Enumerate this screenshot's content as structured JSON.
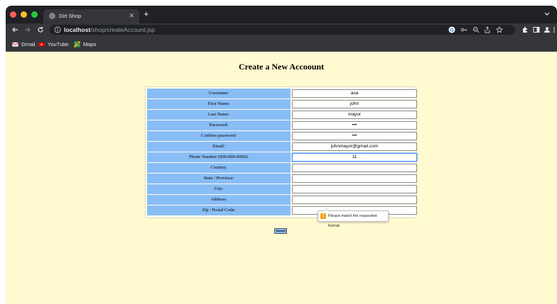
{
  "browser": {
    "tab_title": "Dirt Shop",
    "url_host": "localhost",
    "url_path": "/shop/createAccount.jsp",
    "bookmarks": [
      "Gmail",
      "YouTube",
      "Maps"
    ]
  },
  "page": {
    "title": "Create a New Accoount",
    "submit_label": "Submit",
    "fields": [
      {
        "label": "Username:",
        "value": "asa"
      },
      {
        "label": "First Name:",
        "value": "john"
      },
      {
        "label": "Last Name:",
        "value": "mayor"
      },
      {
        "label": "Password:",
        "value": "•••"
      },
      {
        "label": "Confirm password:",
        "value": "•••"
      },
      {
        "label": "Email:",
        "value": "johnmayor@gmail.com"
      },
      {
        "label": "Phone Number (000-000-0000):",
        "value": "11"
      },
      {
        "label": "Country:",
        "value": ""
      },
      {
        "label": "State / Province:",
        "value": ""
      },
      {
        "label": "City:",
        "value": ""
      },
      {
        "label": "Address:",
        "value": ""
      },
      {
        "label": "Zip / Postal Code:",
        "value": ""
      }
    ],
    "validation_tooltip": "Please match the requested format."
  },
  "colors": {
    "page_background": "#fffad0",
    "label_background": "#89bdf5",
    "warning": "#f4a423"
  }
}
